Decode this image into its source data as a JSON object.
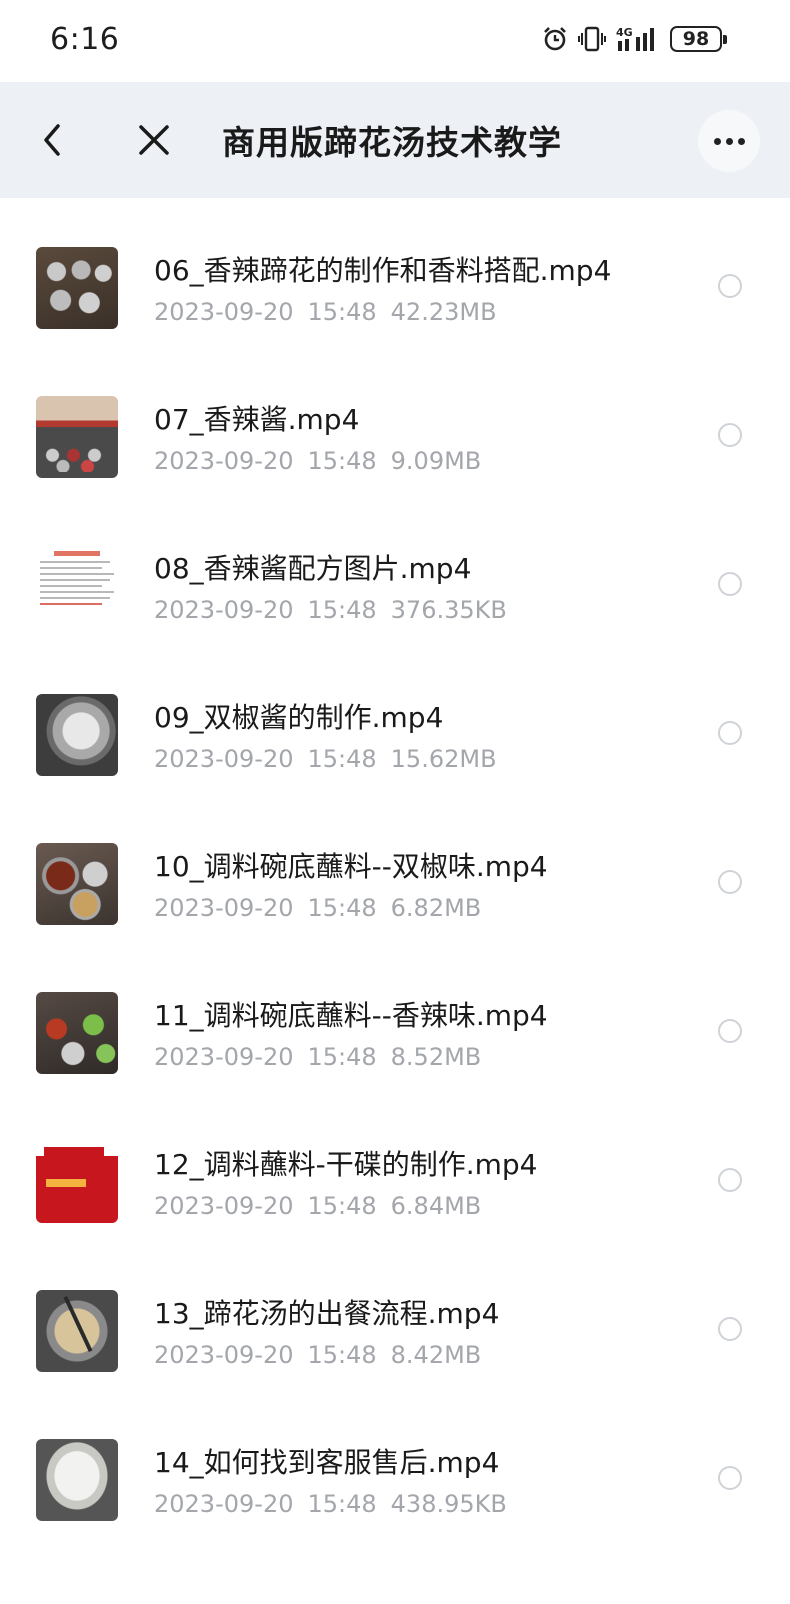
{
  "status_bar": {
    "time": "6:16",
    "network": "4G",
    "battery": "98",
    "icons": [
      "alarm-icon",
      "vibrate-icon",
      "signal-icon",
      "battery-icon"
    ]
  },
  "nav": {
    "title": "商用版蹄花汤技术教学",
    "icons": [
      "back-icon",
      "close-icon",
      "more-icon"
    ]
  },
  "files": [
    {
      "name": "06_香辣蹄花的制作和香料搭配.mp4",
      "date": "2023-09-20",
      "time": "15:48",
      "size": "42.23MB",
      "thumb": "t-bowls"
    },
    {
      "name": "07_香辣酱.mp4",
      "date": "2023-09-20",
      "time": "15:48",
      "size": "9.09MB",
      "thumb": "t-chef"
    },
    {
      "name": "08_香辣酱配方图片.mp4",
      "date": "2023-09-20",
      "time": "15:48",
      "size": "376.35KB",
      "thumb": "t-doc"
    },
    {
      "name": "09_双椒酱的制作.mp4",
      "date": "2023-09-20",
      "time": "15:48",
      "size": "15.62MB",
      "thumb": "t-basin"
    },
    {
      "name": "10_调料碗底蘸料--双椒味.mp4",
      "date": "2023-09-20",
      "time": "15:48",
      "size": "6.82MB",
      "thumb": "t-sauce1"
    },
    {
      "name": "11_调料碗底蘸料--香辣味.mp4",
      "date": "2023-09-20",
      "time": "15:48",
      "size": "8.52MB",
      "thumb": "t-sauce2"
    },
    {
      "name": "12_调料蘸料-干碟的制作.mp4",
      "date": "2023-09-20",
      "time": "15:48",
      "size": "6.84MB",
      "thumb": "t-pack"
    },
    {
      "name": "13_蹄花汤的出餐流程.mp4",
      "date": "2023-09-20",
      "time": "15:48",
      "size": "8.42MB",
      "thumb": "t-pot"
    },
    {
      "name": "14_如何找到客服售后.mp4",
      "date": "2023-09-20",
      "time": "15:48",
      "size": "438.95KB",
      "thumb": "t-soup"
    }
  ]
}
